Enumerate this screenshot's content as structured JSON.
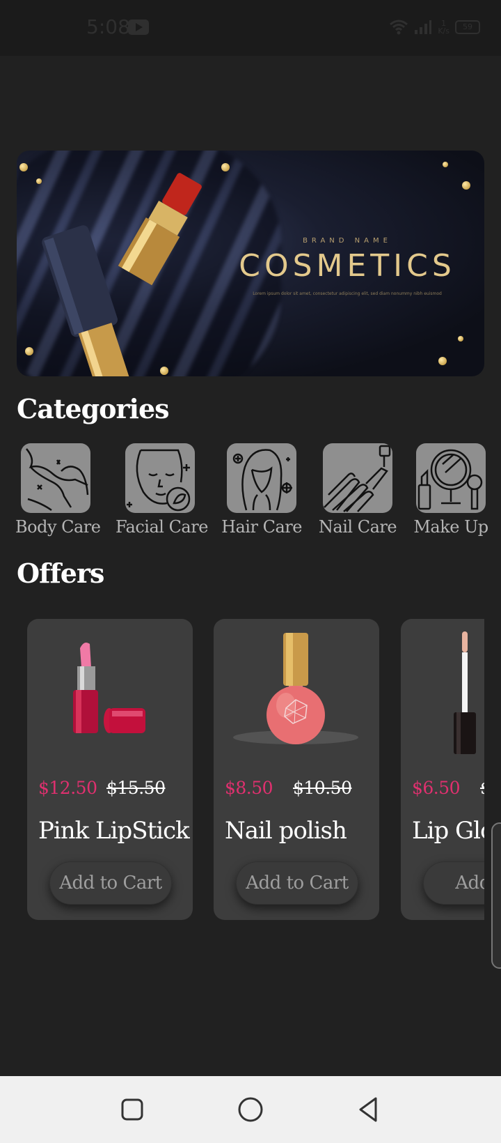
{
  "status_bar": {
    "time": "5:08",
    "net_speed_value": "1",
    "net_speed_unit": "K/s",
    "battery": "59"
  },
  "banner": {
    "brand": "BRAND NAME",
    "title": "COSMETICS",
    "subtitle": "Lorem ipsum dolor sit amet, consectetur adipiscing elit, sed diam nonummy nibh euismod"
  },
  "categories": {
    "title": "Categories",
    "items": [
      {
        "label": "Body Care",
        "icon": "body-care-icon"
      },
      {
        "label": "Facial Care",
        "icon": "facial-care-icon"
      },
      {
        "label": "Hair Care",
        "icon": "hair-care-icon"
      },
      {
        "label": "Nail Care",
        "icon": "nail-care-icon"
      },
      {
        "label": "Make Up",
        "icon": "make-up-icon"
      }
    ]
  },
  "offers": {
    "title": "Offers",
    "items": [
      {
        "price": "$12.50",
        "old_price": "$15.50",
        "name": "Pink LipStick",
        "button": "Add to Cart",
        "image": "pink-lipstick-image"
      },
      {
        "price": "$8.50",
        "old_price": "$10.50",
        "name": "Nail polish",
        "button": "Add to Cart",
        "image": "nail-polish-image"
      },
      {
        "price": "$6.50",
        "old_price": "$",
        "name": "Lip Glos",
        "button": "Add to",
        "image": "lip-gloss-image"
      }
    ]
  },
  "colors": {
    "background": "#212121",
    "card": "#3d3d3d",
    "price_accent": "#e0306f",
    "tile": "#8f8f8f"
  }
}
